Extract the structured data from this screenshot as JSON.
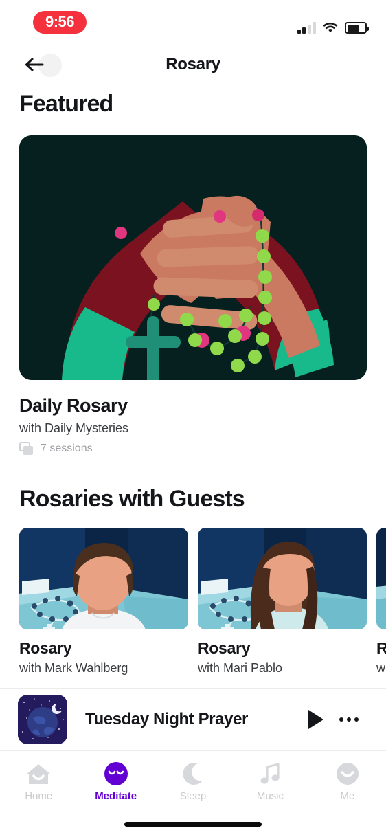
{
  "status_bar": {
    "time": "9:56",
    "time_pill_color": "#f4313d",
    "signal_icon": "cellular-signal-icon",
    "wifi_icon": "wifi-icon",
    "battery_icon": "battery-icon",
    "battery_level_percent": 70
  },
  "nav": {
    "back_icon": "back-arrow-icon",
    "title": "Rosary"
  },
  "featured": {
    "section_title": "Featured",
    "card_image_alt": "praying-hands-with-rosary-illustration",
    "card_bg": "#06201f",
    "title": "Daily Rosary",
    "subtitle": "with Daily Mysteries",
    "sessions_icon": "stacked-cards-icon",
    "sessions_label": "7 sessions"
  },
  "guests": {
    "section_title": "Rosaries with Guests",
    "cards": [
      {
        "title": "Rosary",
        "subtitle": "with Mark Wahlberg",
        "image_alt": "man-with-rosary-illustration"
      },
      {
        "title": "Rosary",
        "subtitle": "with Mari Pablo",
        "image_alt": "woman-with-rosary-illustration"
      },
      {
        "title": "R",
        "subtitle": "w",
        "image_alt": "partial-guest-illustration"
      }
    ]
  },
  "now_playing": {
    "thumbnail_alt": "night-sky-globe-thumbnail",
    "title": "Tuesday Night Prayer",
    "play_icon": "play-icon",
    "more_icon": "more-options-icon"
  },
  "tab_bar": {
    "active_color": "#6200d4",
    "inactive_color": "#c9cacd",
    "items": [
      {
        "label": "Home",
        "icon": "home-icon",
        "active": false
      },
      {
        "label": "Meditate",
        "icon": "meditate-face-icon",
        "active": true
      },
      {
        "label": "Sleep",
        "icon": "moon-icon",
        "active": false
      },
      {
        "label": "Music",
        "icon": "music-note-icon",
        "active": false
      },
      {
        "label": "Me",
        "icon": "profile-icon",
        "active": false
      }
    ]
  }
}
